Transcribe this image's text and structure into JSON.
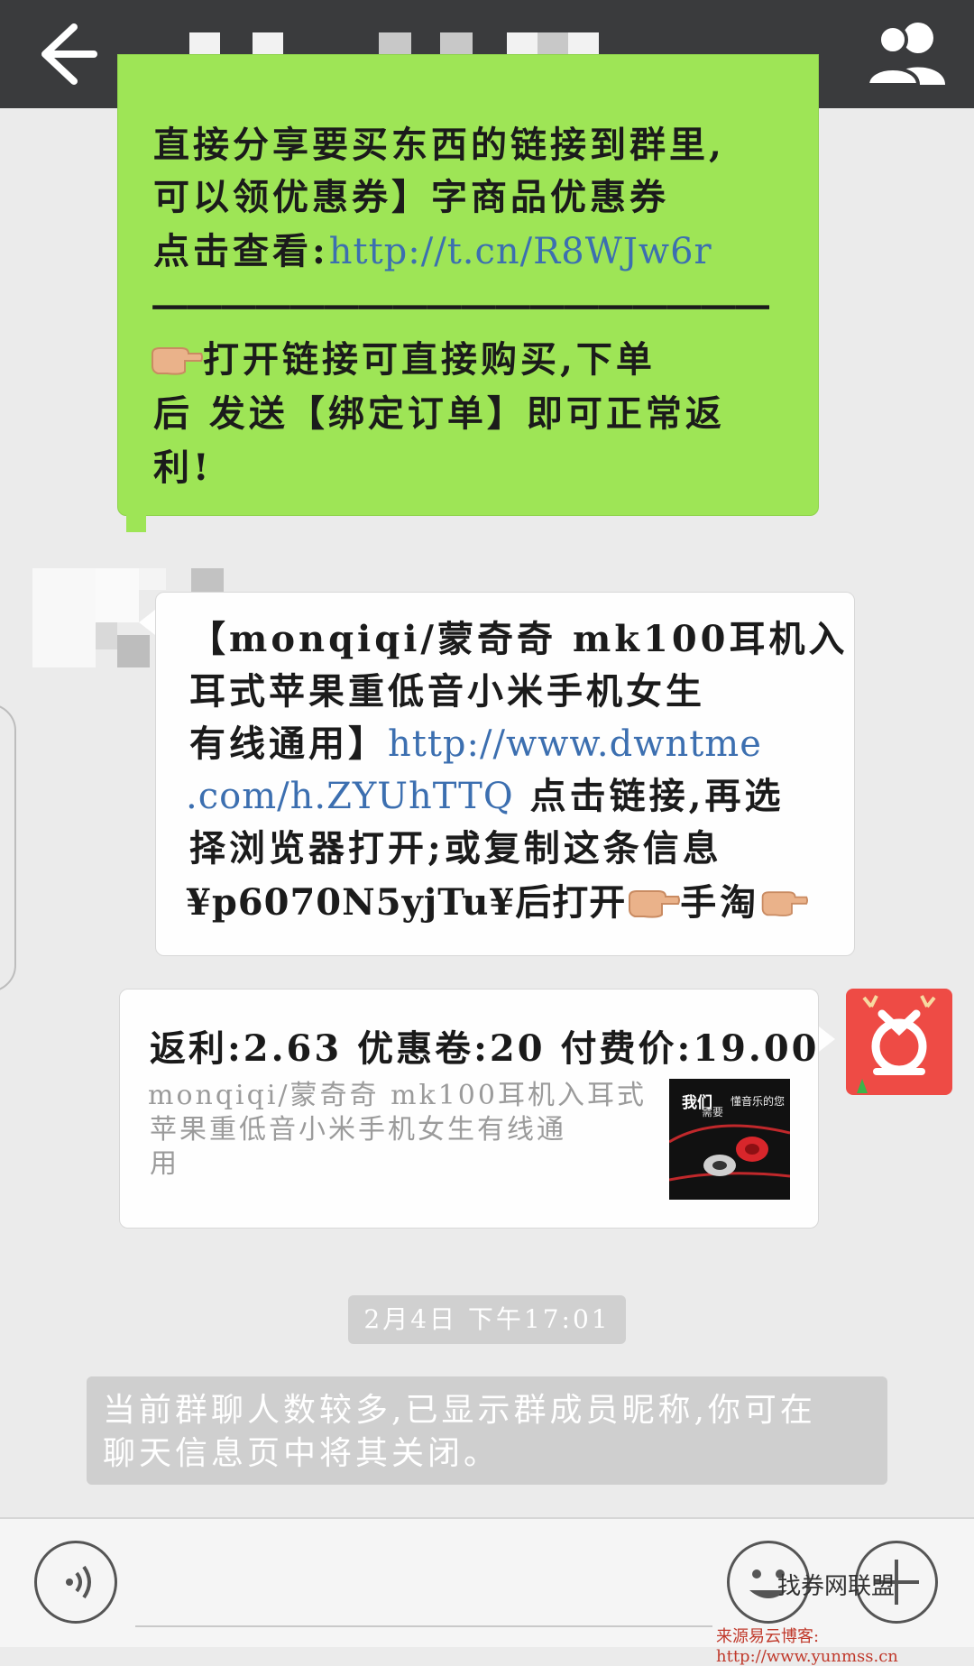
{
  "messages": {
    "green": {
      "line1": "直接分享要买东西的链接到群里,",
      "line2": "可以领优惠券】字商品优惠券",
      "line3_prefix": "点击查看:",
      "line3_link": "http://t.cn/R8WJw6r",
      "dashes": "一一一一一一一一一一一一一一一一一一",
      "line4": "打开链接可直接购买,下单",
      "line5": "后 发送【绑定订单】即可正常返",
      "line6": "利!"
    },
    "white": {
      "line1": "【monqiqi/蒙奇奇 mk100耳机入",
      "line2": "耳式苹果重低音小米手机女生",
      "line3_prefix": "有线通用】",
      "line3_link": "http://www.dwntme",
      "line4_link": ".com/h.ZYUhTTQ",
      "line4_suffix": " 点击链接,再选",
      "line5": "择浏览器打开;或复制这条信息",
      "line6_prefix": "¥p6070N5yjTu¥后打开",
      "line6_mid": "手淘"
    },
    "card": {
      "title": "返利:2.63 优惠卷:20 付费价:19.00",
      "desc1": "monqiqi/蒙奇奇 mk100耳机入耳式",
      "desc2": "苹果重低音小米手机女生有线通",
      "desc3": "用",
      "thumb_text1": "我们",
      "thumb_text2": "需要",
      "thumb_text3": "懂音乐的您"
    }
  },
  "timestamp": "2月4日 下午17:01",
  "system_notice": {
    "line1": "当前群聊人数较多,已显示群成员昵称,你可在",
    "line2": "聊天信息页中将其关闭。"
  },
  "watermark": "找券网联盟",
  "source": "来源易云博客: http://www.yunmss.cn",
  "icons": [
    "back-arrow-icon",
    "group-members-icon",
    "voice-icon",
    "emoji-icon",
    "plus-icon",
    "point-right-emoji-icon"
  ],
  "colors": {
    "topbar": "#3a3b3d",
    "green_bubble": "#9ee556",
    "link": "#3c6fb0",
    "app_avatar": "#ee4b45"
  }
}
